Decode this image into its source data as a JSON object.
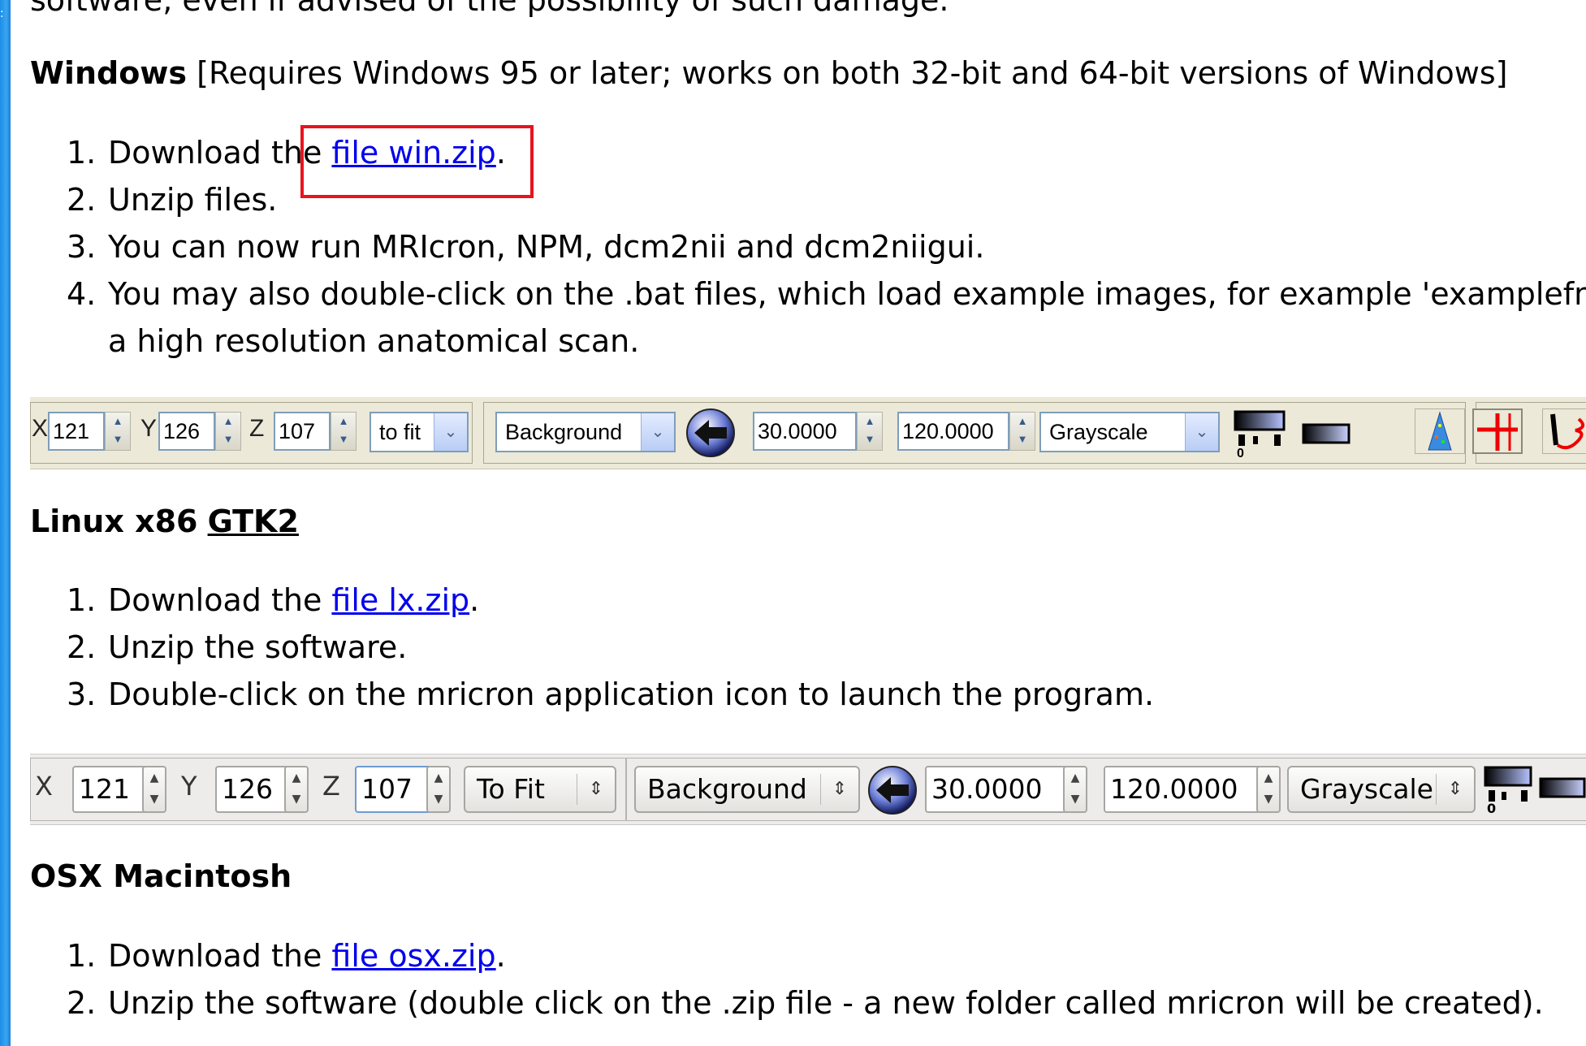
{
  "top_cut_text": "software, even if advised of the possibility of such damage.",
  "windows": {
    "title": "Windows",
    "requirement": "[Requires Windows 95 or later; works on both 32-bit and 64-bit versions of Windows]",
    "steps": [
      {
        "num": "1.",
        "pre": "Download the ",
        "link": "file win.zip",
        "post": "."
      },
      {
        "num": "2.",
        "text": "Unzip files."
      },
      {
        "num": "3.",
        "text": "You can now run MRIcron, NPM, dcm2nii and dcm2niigui."
      },
      {
        "num": "4.",
        "text": "You may also double-click on the .bat files, which load example images, for example 'examplefmri",
        "text2": "a high resolution anatomical scan."
      }
    ],
    "toolbar": {
      "x_label": "X",
      "x_value": "121",
      "y_label": "Y",
      "y_value": "126",
      "z_label": "Z",
      "z_value": "107",
      "zoom": "to fit",
      "layer": "Background",
      "min": "30.0000",
      "max": "120.0000",
      "colormap": "Grayscale"
    }
  },
  "linux": {
    "title": "Linux x86",
    "toolkit": "GTK2",
    "steps": [
      {
        "num": "1.",
        "pre": "Download the ",
        "link": "file lx.zip",
        "post": "."
      },
      {
        "num": "2.",
        "text": "Unzip the software."
      },
      {
        "num": "3.",
        "text": "Double-click on the mricron application icon to launch the program."
      }
    ],
    "toolbar": {
      "x_label": "X",
      "x_value": "121",
      "y_label": "Y",
      "y_value": "126",
      "z_label": "Z",
      "z_value": "107",
      "zoom": "To Fit",
      "layer": "Background",
      "min": "30.0000",
      "max": "120.0000",
      "colormap": "Grayscale"
    }
  },
  "osx": {
    "title": "OSX Macintosh",
    "steps": [
      {
        "num": "1.",
        "pre": "Download the ",
        "link": "file osx.zip",
        "post": "."
      },
      {
        "num": "2.",
        "text": "Unzip the software (double click on the .zip file - a new folder called mricron will be created)."
      }
    ]
  },
  "colors": {
    "link": "#0000ee",
    "highlight": "#e8141e",
    "win_toolbar": "#ece9d8",
    "gtk_toolbar": "#edecea"
  },
  "icons": [
    "up-down-spinner-icon",
    "dropdown-arrow-icon",
    "back-arrow-icon",
    "colorbar-icon",
    "render-cone-icon",
    "crosshair-icon",
    "pen-icon"
  ]
}
